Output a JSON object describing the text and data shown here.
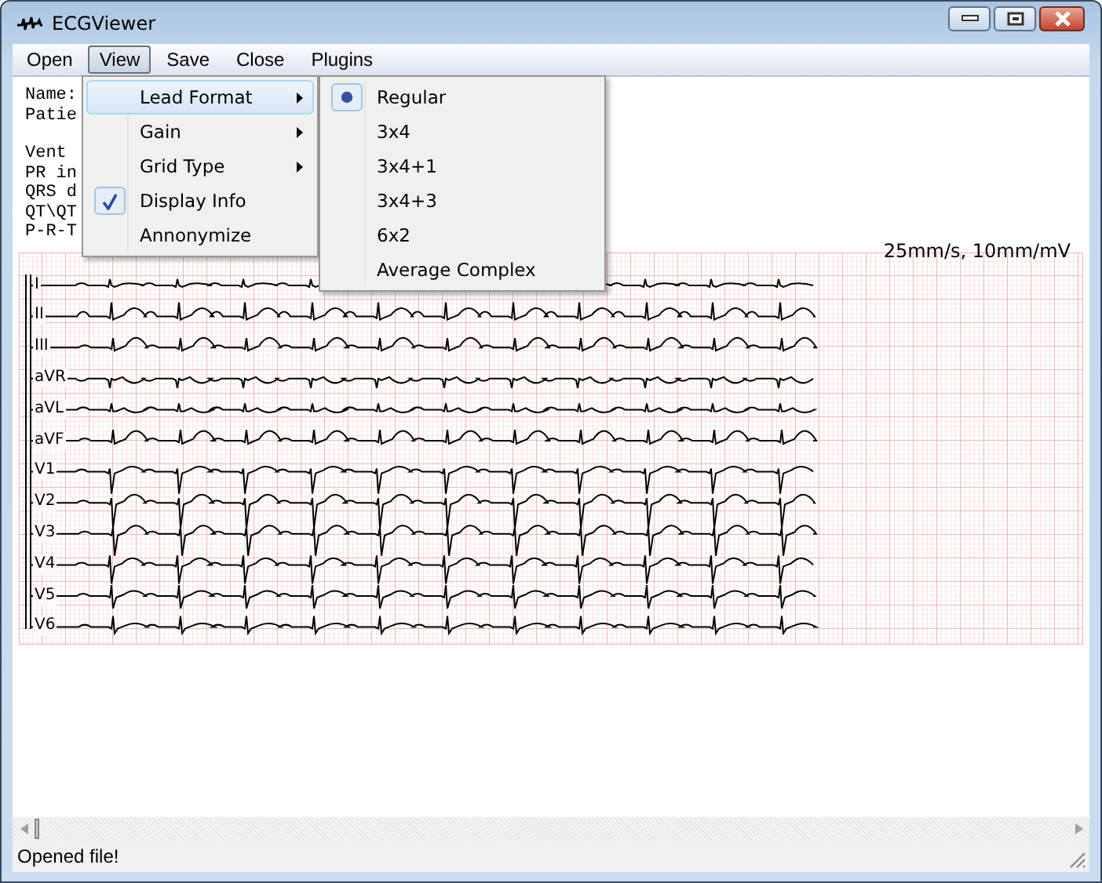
{
  "window": {
    "title": "ECGViewer"
  },
  "menu_bar": [
    {
      "label": "Open",
      "selected": false
    },
    {
      "label": "View",
      "selected": true
    },
    {
      "label": "Save",
      "selected": false
    },
    {
      "label": "Close",
      "selected": false
    },
    {
      "label": "Plugins",
      "selected": false
    }
  ],
  "patient_info": [
    [
      "Name:",
      "Patie"
    ],
    [
      "Vent",
      "PR in",
      "QRS d",
      "QT\\QT",
      "P-R-T"
    ]
  ],
  "ecg": {
    "scale": "25mm/s, 10mm/mV",
    "leads": [
      {
        "label": "I"
      },
      {
        "label": "II"
      },
      {
        "label": "III"
      },
      {
        "label": "aVR"
      },
      {
        "label": "aVL"
      },
      {
        "label": "aVF"
      },
      {
        "label": "V1"
      },
      {
        "label": "V2"
      },
      {
        "label": "V3"
      },
      {
        "label": "V4"
      },
      {
        "label": "V5"
      },
      {
        "label": "V6"
      }
    ]
  },
  "view_menu": [
    {
      "label": "Lead Format",
      "kind": "submenu",
      "selected": true
    },
    {
      "label": "Gain",
      "kind": "submenu",
      "selected": false
    },
    {
      "label": "Grid Type",
      "kind": "submenu",
      "selected": false
    },
    {
      "label": "Display Info",
      "kind": "check",
      "checked": true,
      "selected": false
    },
    {
      "label": "Annonymize",
      "kind": "check",
      "checked": false,
      "selected": false
    }
  ],
  "lead_format_menu": [
    {
      "label": "Regular",
      "selected": true
    },
    {
      "label": "3x4",
      "selected": false
    },
    {
      "label": "3x4+1",
      "selected": false
    },
    {
      "label": "3x4+3",
      "selected": false
    },
    {
      "label": "6x2",
      "selected": false
    },
    {
      "label": "Average Complex",
      "selected": false
    }
  ],
  "status_bar": {
    "text": "Opened file!"
  }
}
